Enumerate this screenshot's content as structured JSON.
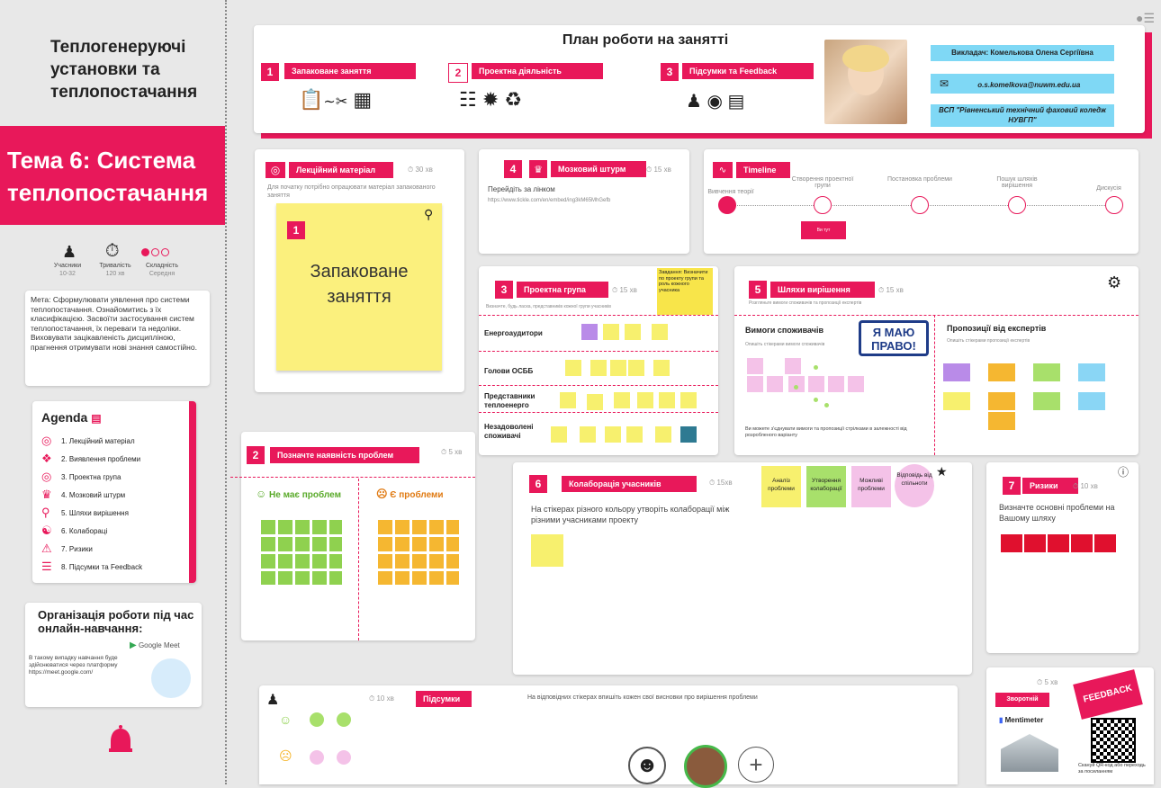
{
  "left": {
    "course_title": "Теплогенеруючі установки та теплопостачання",
    "topic": "Тема 6: Система теплопостачання",
    "stats": [
      {
        "label": "Учасники",
        "value": "10-32"
      },
      {
        "label": "Тривалість",
        "value": "120 хв"
      },
      {
        "label": "Складність",
        "value": "Середня"
      }
    ],
    "goal": "Мета: Сформулювати уявлення про системи теплопостачання. Ознайомитись з їх класифікацією. Засвоїти застосування систем теплопостачання, їх переваги та недоліки. Виховувати зацікавленість дисципліною, прагнення отримувати нові знання самостійно.",
    "agenda_title": "Agenda",
    "agenda": [
      "1. Лекційний матеріал",
      "2. Виявлення проблеми",
      "3. Проектна група",
      "4. Мозковий штурм",
      "5. Шляхи вирішення",
      "6. Колабораці",
      "7. Ризики",
      "8. Підсумки та Feedback"
    ],
    "online_title": "Організація роботи під час онлайн-навчання:",
    "meet_label": "Google Meet",
    "online_text": "В такому випадку навчання буде здійснюватися через платформу https://meet.google.com/"
  },
  "plan": {
    "title": "План роботи на занятті",
    "steps": [
      {
        "num": "1",
        "label": "Запаковане заняття"
      },
      {
        "num": "2",
        "label": "Проектна діяльність"
      },
      {
        "num": "3",
        "label": "Підсумки та Feedback"
      }
    ],
    "teacher": "Викладач: Комелькова Олена Сергіївна",
    "email": "o.s.komelkova@nuwm.edu.ua",
    "college": "ВСП \"Рівненський технічний фаховий коледж НУВГП\""
  },
  "lecture": {
    "tag": "Лекційний матеріал",
    "timer": "30 хв",
    "hint": "Для початку потрібно опрацювати матеріал запакованого заняття",
    "sticky_num": "1",
    "sticky_text": "Запаковане заняття"
  },
  "brainstorm": {
    "num": "4",
    "tag": "Мозковий штурм",
    "timer": "15 хв",
    "text": "Перейдіть за лінком",
    "link": "https://www.tickle.com/en/embed/ing3kM65MhGefb"
  },
  "timeline": {
    "tag": "Timeline",
    "steps": [
      "Вивчення теорії",
      "Створення проектної групи",
      "Постановка проблеми",
      "Пошук шляхів вирішення",
      "Дискусія"
    ],
    "note": "Ви тут"
  },
  "project": {
    "num": "3",
    "tag": "Проектна група",
    "timer": "15 хв",
    "hint": "Визначте, будь ласка, представників кожної групи учасників",
    "note": "Завдання: Визначити по проекту групи та роль кожного учасника",
    "rows": [
      "Енергоаудитори",
      "Голови ОСББ",
      "Представники теплоенерго",
      "Незадоволені споживачі"
    ]
  },
  "solutions": {
    "num": "5",
    "tag": "Шляхи вирішення",
    "timer": "15 хв",
    "hint": "Розгляньте вимоги споживачів та пропозиції експертів",
    "left_title": "Вимоги споживачів",
    "left_hint": "Опишіть стікерами вимоги споживачів",
    "right_title": "Пропозиції від експертів",
    "right_hint": "Опишіть стікерами пропозиції експертів",
    "badge_line1": "Я МАЮ",
    "badge_line2": "ПРАВО!",
    "footer": "Ви можете з'єднувати вимоги та пропозиції стрілками в залежності від розробленого варіанту"
  },
  "problems": {
    "num": "2",
    "tag": "Позначте наявність проблем",
    "timer": "5 хв",
    "no_label": "Не має проблем",
    "yes_label": "Є проблеми"
  },
  "collab": {
    "num": "6",
    "tag": "Колаборація учасників",
    "timer": "15хв",
    "text": "На стікерах різного кольору утворіть колаборації між різними учасниками проекту",
    "chips": [
      "Аналіз проблеми",
      "Утворення колаборації",
      "Можливі проблеми",
      "Відповідь від спільноти"
    ]
  },
  "risks": {
    "num": "7",
    "tag": "Ризики",
    "timer": "10 хв",
    "text": "Визначте основні проблеми на Вашому шляху"
  },
  "summary": {
    "timer": "10 хв",
    "tag": "Підсумки",
    "text": "На відповідних стікерах впишіть кожен свої висновки про вирішення проблеми"
  },
  "feedback": {
    "timer": "5 хв",
    "button": "Зворотній зв'язок",
    "brand": "Mentimeter",
    "stamp": "FEEDBACK",
    "caption": "Скануй QR-код або переходь за посиланням"
  }
}
